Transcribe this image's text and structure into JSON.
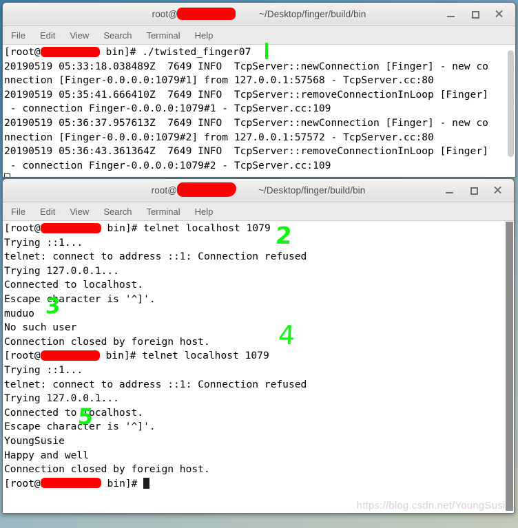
{
  "watermark": "https://blog.csdn.net/YoungSusie",
  "menu": {
    "items": [
      "File",
      "Edit",
      "View",
      "Search",
      "Terminal",
      "Help"
    ]
  },
  "window_controls": {
    "minimize": "minimize-button",
    "maximize": "maximize-button",
    "close": "close-button"
  },
  "top_window": {
    "title_prefix": "root@",
    "title_suffix": "~/Desktop/finger/build/bin",
    "lines": [
      {
        "type": "prompt",
        "prefix": "[root@",
        "suffix": " bin]# ./twisted_finger07"
      },
      {
        "type": "text",
        "text": "20190519 05:33:18.038489Z  7649 INFO  TcpServer::newConnection [Finger] - new co"
      },
      {
        "type": "text",
        "text": "nnection [Finger-0.0.0.0:1079#1] from 127.0.0.1:57568 - TcpServer.cc:80"
      },
      {
        "type": "text",
        "text": "20190519 05:35:41.666410Z  7649 INFO  TcpServer::removeConnectionInLoop [Finger]"
      },
      {
        "type": "text",
        "text": " - connection Finger-0.0.0.0:1079#1 - TcpServer.cc:109"
      },
      {
        "type": "text",
        "text": "20190519 05:36:37.957613Z  7649 INFO  TcpServer::newConnection [Finger] - new co"
      },
      {
        "type": "text",
        "text": "nnection [Finger-0.0.0.0:1079#2] from 127.0.0.1:57572 - TcpServer.cc:80"
      },
      {
        "type": "text",
        "text": "20190519 05:36:43.361364Z  7649 INFO  TcpServer::removeConnectionInLoop [Finger]"
      },
      {
        "type": "text",
        "text": " - connection Finger-0.0.0.0:1079#2 - TcpServer.cc:109"
      },
      {
        "type": "cursor-hollow",
        "text": ""
      }
    ]
  },
  "bottom_window": {
    "title_prefix": "root@",
    "title_suffix": "~/Desktop/finger/build/bin",
    "lines": [
      {
        "type": "prompt",
        "prefix": "[root@",
        "suffix": " bin]# telnet localhost 1079"
      },
      {
        "type": "text",
        "text": "Trying ::1..."
      },
      {
        "type": "text",
        "text": "telnet: connect to address ::1: Connection refused"
      },
      {
        "type": "text",
        "text": "Trying 127.0.0.1..."
      },
      {
        "type": "text",
        "text": "Connected to localhost."
      },
      {
        "type": "text",
        "text": "Escape character is '^]'."
      },
      {
        "type": "text",
        "text": "muduo"
      },
      {
        "type": "text",
        "text": "No such user"
      },
      {
        "type": "text",
        "text": "Connection closed by foreign host."
      },
      {
        "type": "prompt",
        "prefix": "[root@",
        "suffix": " bin]# telnet localhost 1079"
      },
      {
        "type": "text",
        "text": "Trying ::1..."
      },
      {
        "type": "text",
        "text": "telnet: connect to address ::1: Connection refused"
      },
      {
        "type": "text",
        "text": "Trying 127.0.0.1..."
      },
      {
        "type": "text",
        "text": "Connected to localhost."
      },
      {
        "type": "text",
        "text": "Escape character is '^]'."
      },
      {
        "type": "text",
        "text": "YoungSusie"
      },
      {
        "type": "text",
        "text": "Happy and well"
      },
      {
        "type": "text",
        "text": "Connection closed by foreign host."
      },
      {
        "type": "prompt-cursor",
        "prefix": "[root@",
        "suffix": " bin]# "
      }
    ]
  },
  "annotations": [
    {
      "id": "1",
      "label": "1"
    },
    {
      "id": "2",
      "label": "2"
    },
    {
      "id": "3",
      "label": "3"
    },
    {
      "id": "4",
      "label": "4"
    },
    {
      "id": "5",
      "label": "5"
    }
  ],
  "colors": {
    "annotation_green": "#12f312",
    "redaction_red": "#fb0303",
    "terminal_bg": "#ffffff",
    "terminal_fg": "#000000"
  }
}
